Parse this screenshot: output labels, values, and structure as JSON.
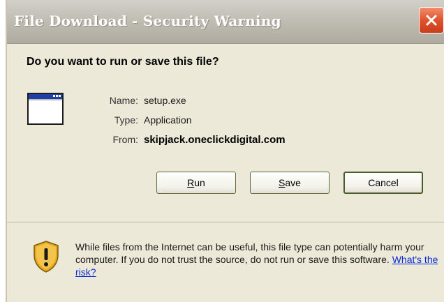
{
  "window": {
    "title": "File Download - Security Warning"
  },
  "dialog": {
    "question": "Do you want to run or save this file?",
    "file": {
      "name_label": "Name:",
      "name_value": "setup.exe",
      "type_label": "Type:",
      "type_value": "Application",
      "from_label": "From:",
      "from_value": "skipjack.oneclickdigital.com"
    },
    "buttons": {
      "run_mnemonic": "R",
      "run_rest": "un",
      "save_mnemonic": "S",
      "save_rest": "ave",
      "cancel": "Cancel"
    },
    "warning": {
      "text": "While files from the Internet can be useful, this file type can potentially harm your computer. If you do not trust the source, do not run or save this software. ",
      "link": "What's the risk?"
    }
  },
  "colors": {
    "window_bg": "#ece9d8",
    "titlebar": "#bdbab0",
    "close_button": "#e0532d",
    "link": "#0b2bd6",
    "shield_gold": "#e8a817"
  },
  "icons": {
    "close": "close-icon",
    "file": "application-window-icon",
    "warning": "security-shield-icon"
  }
}
